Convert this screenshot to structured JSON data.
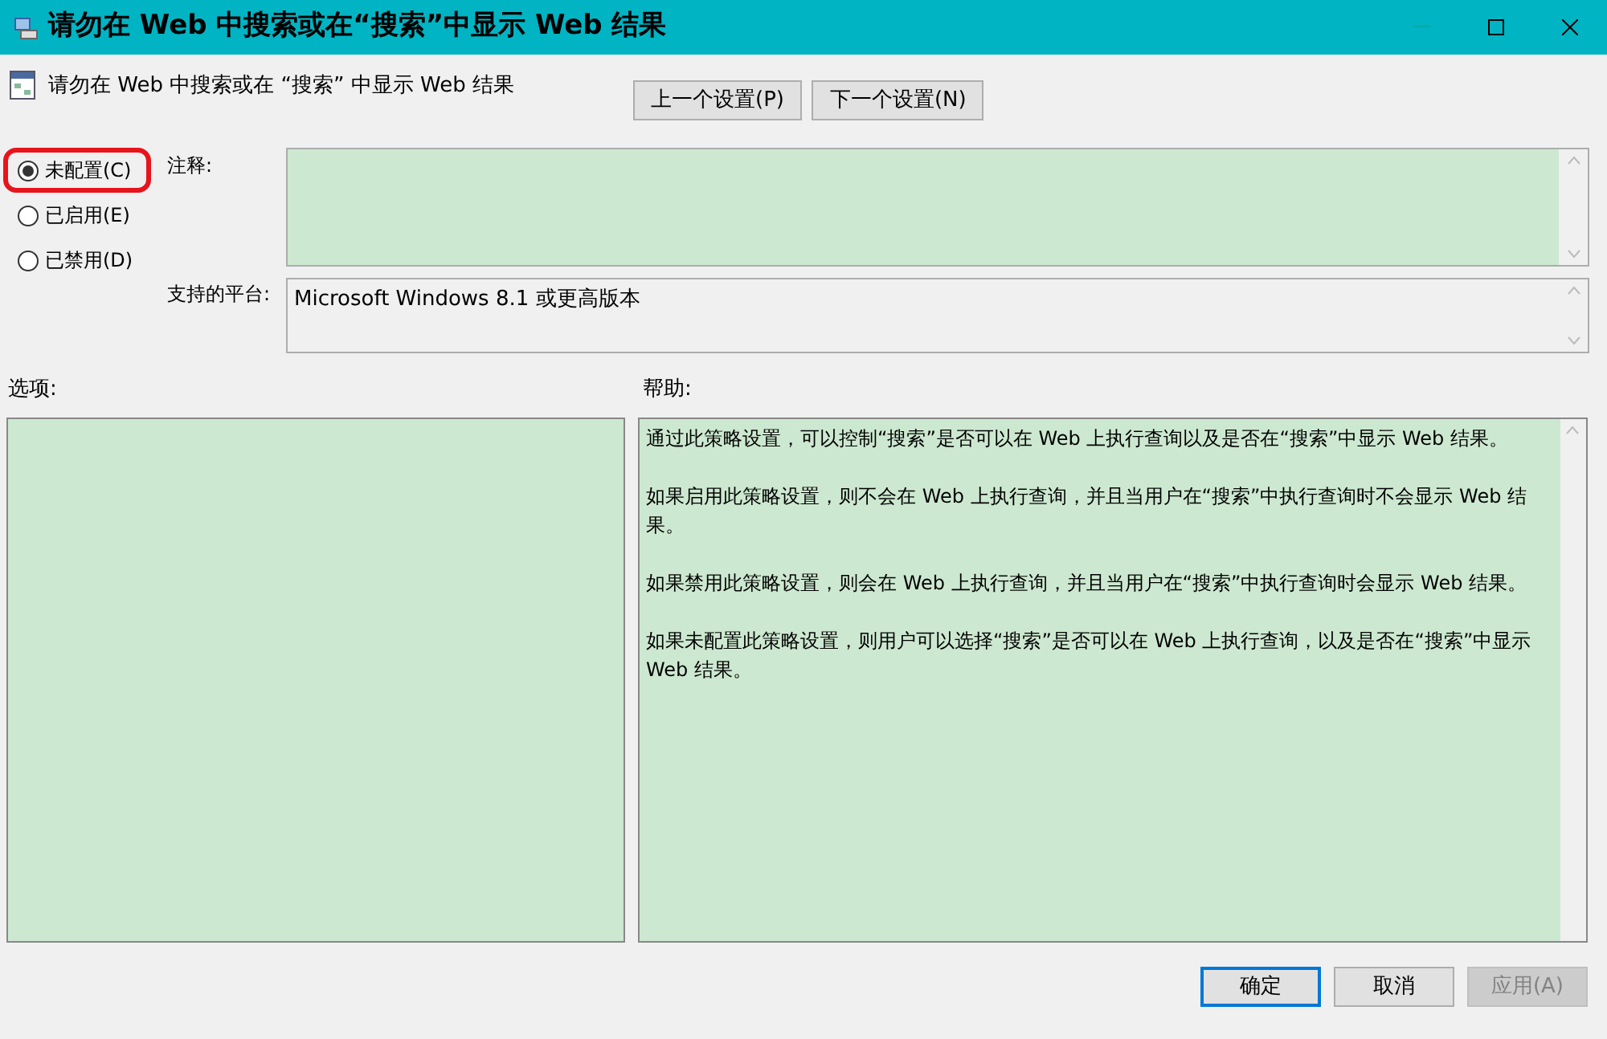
{
  "window": {
    "title": "请勿在 Web 中搜索或在“搜索”中显示 Web 结果"
  },
  "setting_name": "请勿在 Web 中搜索或在 “搜索” 中显示 Web 结果",
  "nav_buttons": [
    {
      "label": "上一个设置(P)"
    },
    {
      "label": "下一个设置(N)"
    }
  ],
  "options": [
    {
      "label": "未配置(C)",
      "selected": true,
      "highlighted": true
    },
    {
      "label": "已启用(E)",
      "selected": false,
      "highlighted": false
    },
    {
      "label": "已禁用(D)",
      "selected": false,
      "highlighted": false
    }
  ],
  "comment": {
    "label": "注释:"
  },
  "platform": {
    "label": "支持的平台:",
    "value": "Microsoft Windows 8.1 或更高版本"
  },
  "options_label": "选项:",
  "help_label": "帮助:",
  "help_paragraphs": [
    "通过此策略设置，可以控制“搜索”是否可以在 Web 上执行查询以及是否在“搜索”中显示 Web 结果。",
    "如果启用此策略设置，则不会在 Web 上执行查询，并且当用户在“搜索”中执行查询时不会显示 Web 结果。",
    "如果禁用此策略设置，则会在 Web 上执行查询，并且当用户在“搜索”中执行查询时会显示 Web 结果。",
    "如果未配置此策略设置，则用户可以选择“搜索”是否可以在 Web 上执行查询，以及是否在“搜索”中显示 Web 结果。"
  ],
  "buttons": [
    {
      "label": "确定",
      "kind": "default",
      "disabled": false
    },
    {
      "label": "取消",
      "kind": "normal",
      "disabled": false
    },
    {
      "label": "应用(A)",
      "kind": "normal",
      "disabled": true
    }
  ]
}
